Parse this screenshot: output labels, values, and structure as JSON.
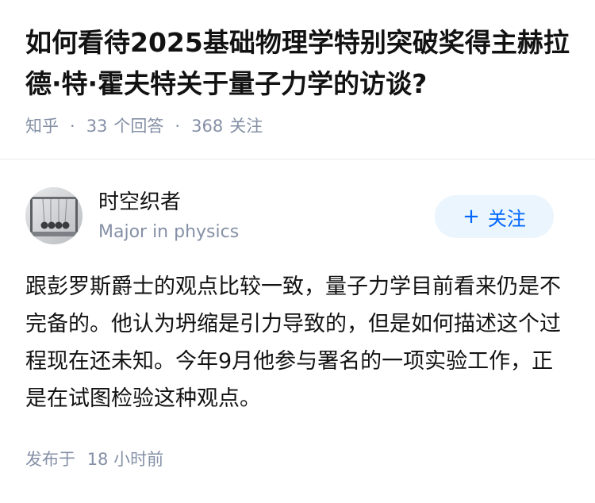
{
  "question": {
    "title": "如何看待2025基础物理学特别突破奖得主赫拉德·特·霍夫特关于量子力学的访谈?",
    "source": "知乎",
    "separator": "·",
    "answer_count": "33",
    "answer_unit": "个回答",
    "follower_count": "368",
    "follower_unit": "关注"
  },
  "author": {
    "name": "时空织者",
    "bio": "Major in physics",
    "avatar_icon": "avatar-newtons-cradle-icon",
    "follow_plus": "+",
    "follow_label": "关注"
  },
  "answer": {
    "text": "跟彭罗斯爵士的观点比较一致，量子力学目前看来仍是不完备的。他认为坍缩是引力导致的，但是如何描述这个过程现在还未知。今年9月他参与署名的一项实验工作，正是在试图检验这种观点。",
    "published_prefix": "发布于",
    "published_time": "18 小时前"
  },
  "colors": {
    "title": "#121212",
    "meta": "#8590a6",
    "accent": "#0066ff",
    "follow_bg": "#ebf5fd",
    "divider": "#ebebeb"
  }
}
